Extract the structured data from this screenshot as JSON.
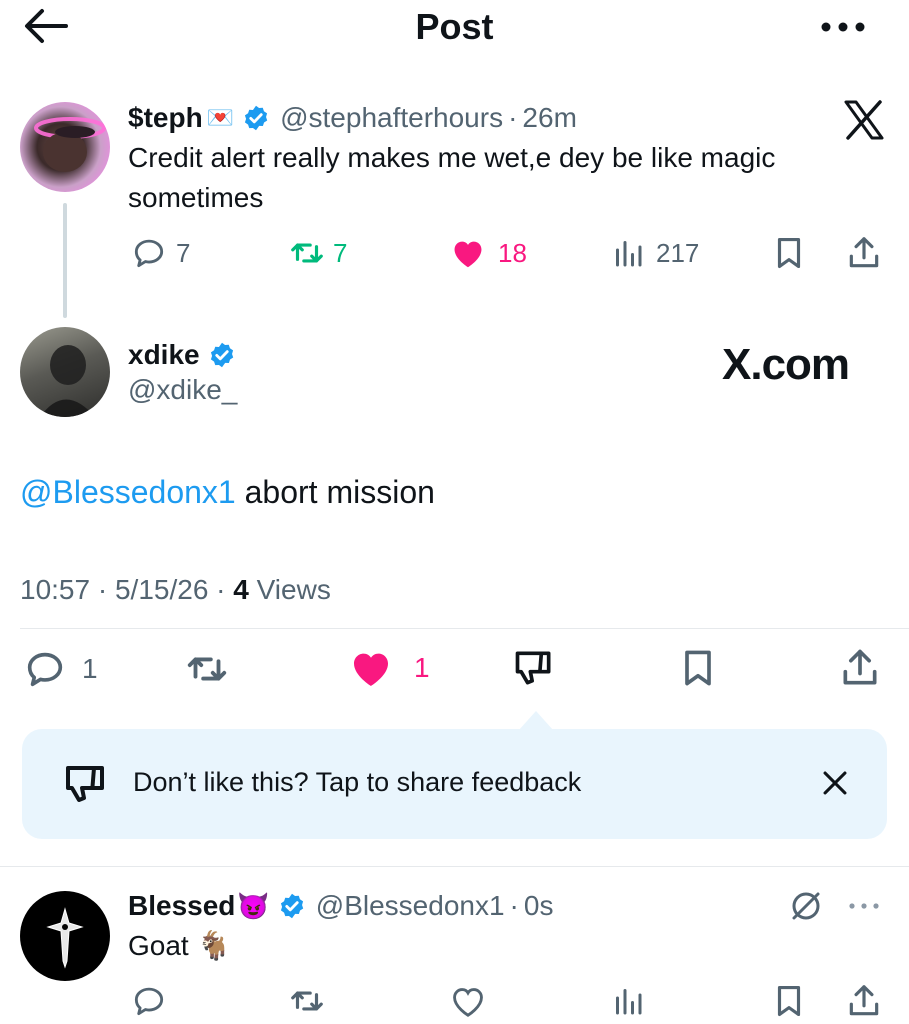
{
  "header": {
    "title": "Post",
    "back_icon": "arrow-left-icon",
    "more_icon": "more-horizontal-icon"
  },
  "parent_post": {
    "author_name": "$teph",
    "author_emoji": "💌",
    "handle": "@stephafterhours",
    "separator": "·",
    "time": "26m",
    "text": "Credit alert really makes me wet,e dey be like magic sometimes",
    "replies": "7",
    "reposts": "7",
    "likes": "18",
    "views": "217"
  },
  "main_post": {
    "author_name": "xdike",
    "handle": "@xdike_",
    "watermark": "X.com",
    "mention": "@Blessedonx1",
    "text": " abort mission",
    "time": "10:57",
    "date": "5/15/26",
    "views_count": "4",
    "views_label": "Views",
    "replies": "1",
    "likes": "1"
  },
  "feedback": {
    "text": "Don’t like this? Tap to share feedback"
  },
  "reply_post": {
    "author_name": "Blessed",
    "author_emoji": "😈",
    "handle": "@Blessedonx1",
    "separator": "·",
    "time": "0s",
    "text": "Goat 🐐"
  },
  "colors": {
    "blue": "#1d9bf0",
    "like_pink": "#f91880",
    "repost_green": "#00ba7c",
    "gray": "#536471",
    "feedback_bg": "#e9f5fd"
  }
}
